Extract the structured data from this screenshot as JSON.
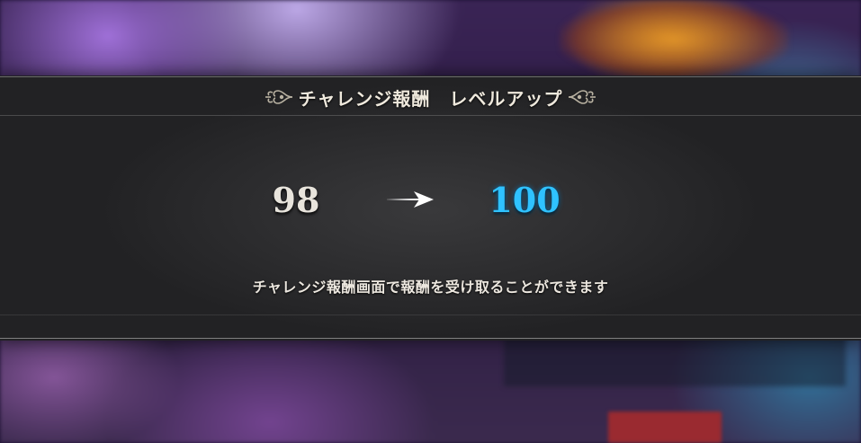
{
  "dialog": {
    "title": "チャレンジ報酬　レベルアップ",
    "level_from": "98",
    "level_to": "100",
    "message": "チャレンジ報酬画面で報酬を受け取ることができます"
  },
  "colors": {
    "accent_new_level": "#2fc2ff",
    "band_background": "#2a2a2c",
    "text": "#efe9dd"
  },
  "icons": {
    "left_ornament": "ornament-icon",
    "right_ornament": "ornament-icon",
    "arrow": "arrow-right-icon"
  }
}
